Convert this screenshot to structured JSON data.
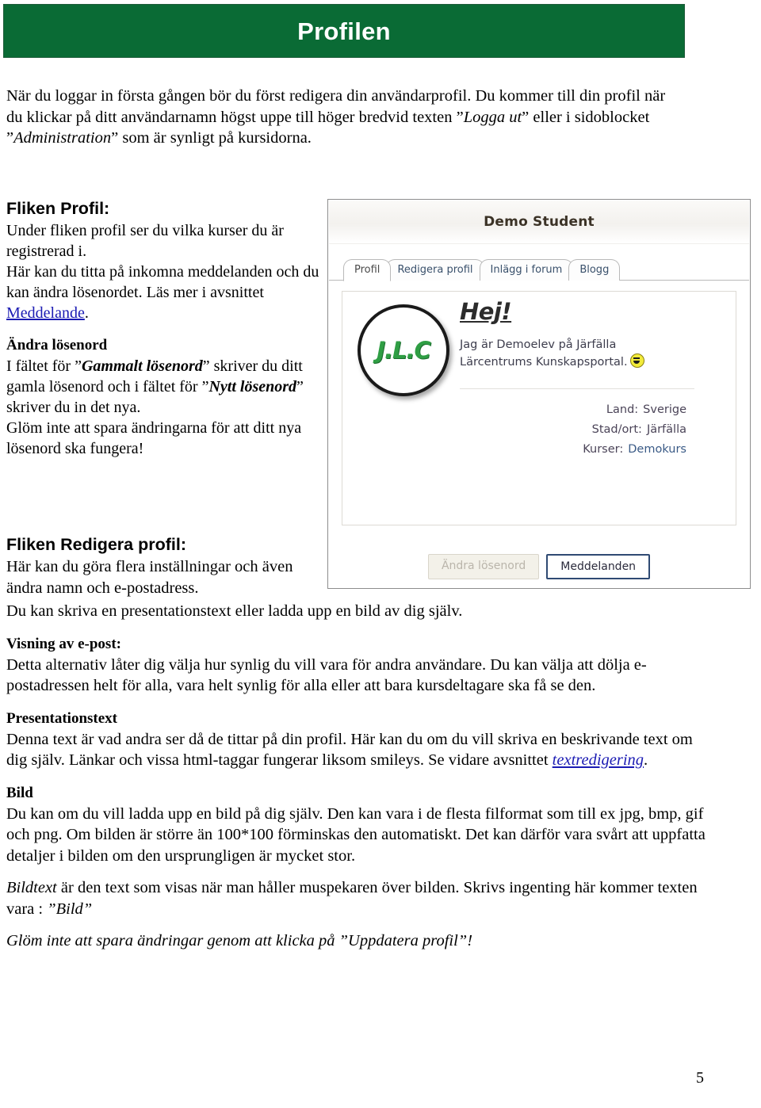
{
  "banner": {
    "title": "Profilen",
    "bg_color": "#0a6b35",
    "text_color": "#ffffff"
  },
  "intro": {
    "line": "När du loggar in första gången bör du först redigera din användarprofil. Du kommer till din profil när du klickar på ditt användarnamn högst uppe till höger bredvid texten ”Logga ut” eller i sidoblocket ”Administration” som är synligt på kursidorna.",
    "italic_1": "Logga ut",
    "italic_2": "Administration"
  },
  "sections": {
    "profil_heading": "Fliken Profil:",
    "profil_body_1": "Under fliken profil ser du vilka kurser du är registrerad i.",
    "profil_body_2": "Här kan du titta på inkomna meddelanden och du kan ändra lösenordet. Läs mer i avsnittet ",
    "profil_link": "Meddelande",
    "profil_body_2_end": ".",
    "andra_losenord_heading": "Ändra lösenord",
    "andra_losenord_body_1_a": "I fältet för ”",
    "andra_losenord_body_1_i1": "Gammalt lösenord",
    "andra_losenord_body_1_b": "” skriver du ditt gamla lösenord och i fältet för ”",
    "andra_losenord_body_1_i2": "Nytt lösenord",
    "andra_losenord_body_1_c": "” skriver du in det nya.",
    "andra_losenord_body_2": "Glöm inte att spara ändringarna för att ditt nya lösenord ska fungera!",
    "redigera_heading": "Fliken Redigera profil:",
    "redigera_body_1": "Här kan du göra flera inställningar och även ändra namn och e-postadress.",
    "redigera_body_2": "Du kan skriva en presentationstext eller ladda upp en bild av dig själv.",
    "visning_heading": "Visning av e-post:",
    "visning_body": "Detta alternativ låter dig välja hur synlig du vill vara för andra användare. Du kan välja att dölja e-postadressen helt för alla, vara helt synlig för alla eller att bara kursdeltagare ska få se den.",
    "presentationstext_heading": "Presentationstext",
    "presentationstext_body_a": "Denna text är vad andra ser då de tittar på din profil. Här kan du om du vill skriva en beskrivande text om dig själv. Länkar och vissa html-taggar fungerar liksom smileys. Se vidare avsnittet ",
    "presentationstext_link": "textredigering",
    "presentationstext_body_b": ".",
    "bild_heading": "Bild",
    "bild_body_1": "Du kan om du vill ladda upp en bild på dig själv. Den kan vara i de flesta filformat som till ex jpg, bmp, gif och png. Om bilden är större än 100*100 förminskas den automatiskt. Det kan därför vara svårt att uppfatta detaljer i bilden om den ursprungligen är mycket stor.",
    "bildtext_italic": "Bildtext",
    "bild_body_2": " är den text som visas när man håller muspekaren över bilden. Skrivs ingenting här kommer texten vara : ",
    "bild_body_2_quote": "”Bild”",
    "footer_note": "Glöm inte att spara ändringar genom att klicka på ”Uppdatera profil”!"
  },
  "screenshot": {
    "username": "Demo Student",
    "tabs": [
      {
        "label": "Profil",
        "active": true
      },
      {
        "label": "Redigera profil",
        "active": false
      },
      {
        "label": "Inlägg i forum",
        "active": false
      },
      {
        "label": "Blogg",
        "active": false
      }
    ],
    "avatar_text": "J.L.C",
    "greeting": "Hej!",
    "bio_line_1": "Jag är Demoelev på Järfälla",
    "bio_line_2": "Lärcentrums Kunskapsportal.",
    "fields": [
      {
        "label": "Land:",
        "value": "Sverige",
        "is_link": false
      },
      {
        "label": "Stad/ort:",
        "value": "Järfälla",
        "is_link": false
      },
      {
        "label": "Kurser:",
        "value": "Demokurs",
        "is_link": true
      }
    ],
    "buttons": [
      {
        "label": "Ändra lösenord",
        "state": "disabled"
      },
      {
        "label": "Meddelanden",
        "state": "primary"
      }
    ]
  },
  "page_number": "5"
}
